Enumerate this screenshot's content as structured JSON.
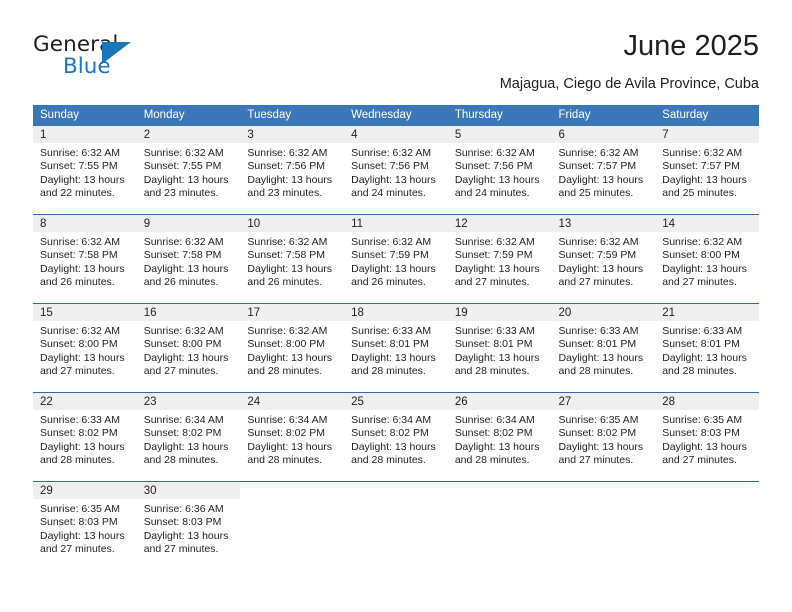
{
  "brand": {
    "name_top": "General",
    "name_bottom": "Blue",
    "accent_color": "#1b75bb",
    "text_color": "#231f20"
  },
  "header": {
    "title": "June 2025",
    "subtitle": "Majagua, Ciego de Avila Province, Cuba"
  },
  "calendar": {
    "header_bg": "#3a76b8",
    "header_text_color": "#ffffff",
    "daynum_bg": "#efefef",
    "row_divider_color": "#2f6aae",
    "weekdays": [
      "Sunday",
      "Monday",
      "Tuesday",
      "Wednesday",
      "Thursday",
      "Friday",
      "Saturday"
    ],
    "weeks": [
      [
        {
          "day": "1",
          "sunrise": "Sunrise: 6:32 AM",
          "sunset": "Sunset: 7:55 PM",
          "daylight_line1": "Daylight: 13 hours",
          "daylight_line2": "and 22 minutes."
        },
        {
          "day": "2",
          "sunrise": "Sunrise: 6:32 AM",
          "sunset": "Sunset: 7:55 PM",
          "daylight_line1": "Daylight: 13 hours",
          "daylight_line2": "and 23 minutes."
        },
        {
          "day": "3",
          "sunrise": "Sunrise: 6:32 AM",
          "sunset": "Sunset: 7:56 PM",
          "daylight_line1": "Daylight: 13 hours",
          "daylight_line2": "and 23 minutes."
        },
        {
          "day": "4",
          "sunrise": "Sunrise: 6:32 AM",
          "sunset": "Sunset: 7:56 PM",
          "daylight_line1": "Daylight: 13 hours",
          "daylight_line2": "and 24 minutes."
        },
        {
          "day": "5",
          "sunrise": "Sunrise: 6:32 AM",
          "sunset": "Sunset: 7:56 PM",
          "daylight_line1": "Daylight: 13 hours",
          "daylight_line2": "and 24 minutes."
        },
        {
          "day": "6",
          "sunrise": "Sunrise: 6:32 AM",
          "sunset": "Sunset: 7:57 PM",
          "daylight_line1": "Daylight: 13 hours",
          "daylight_line2": "and 25 minutes."
        },
        {
          "day": "7",
          "sunrise": "Sunrise: 6:32 AM",
          "sunset": "Sunset: 7:57 PM",
          "daylight_line1": "Daylight: 13 hours",
          "daylight_line2": "and 25 minutes."
        }
      ],
      [
        {
          "day": "8",
          "sunrise": "Sunrise: 6:32 AM",
          "sunset": "Sunset: 7:58 PM",
          "daylight_line1": "Daylight: 13 hours",
          "daylight_line2": "and 26 minutes."
        },
        {
          "day": "9",
          "sunrise": "Sunrise: 6:32 AM",
          "sunset": "Sunset: 7:58 PM",
          "daylight_line1": "Daylight: 13 hours",
          "daylight_line2": "and 26 minutes."
        },
        {
          "day": "10",
          "sunrise": "Sunrise: 6:32 AM",
          "sunset": "Sunset: 7:58 PM",
          "daylight_line1": "Daylight: 13 hours",
          "daylight_line2": "and 26 minutes."
        },
        {
          "day": "11",
          "sunrise": "Sunrise: 6:32 AM",
          "sunset": "Sunset: 7:59 PM",
          "daylight_line1": "Daylight: 13 hours",
          "daylight_line2": "and 26 minutes."
        },
        {
          "day": "12",
          "sunrise": "Sunrise: 6:32 AM",
          "sunset": "Sunset: 7:59 PM",
          "daylight_line1": "Daylight: 13 hours",
          "daylight_line2": "and 27 minutes."
        },
        {
          "day": "13",
          "sunrise": "Sunrise: 6:32 AM",
          "sunset": "Sunset: 7:59 PM",
          "daylight_line1": "Daylight: 13 hours",
          "daylight_line2": "and 27 minutes."
        },
        {
          "day": "14",
          "sunrise": "Sunrise: 6:32 AM",
          "sunset": "Sunset: 8:00 PM",
          "daylight_line1": "Daylight: 13 hours",
          "daylight_line2": "and 27 minutes."
        }
      ],
      [
        {
          "day": "15",
          "sunrise": "Sunrise: 6:32 AM",
          "sunset": "Sunset: 8:00 PM",
          "daylight_line1": "Daylight: 13 hours",
          "daylight_line2": "and 27 minutes."
        },
        {
          "day": "16",
          "sunrise": "Sunrise: 6:32 AM",
          "sunset": "Sunset: 8:00 PM",
          "daylight_line1": "Daylight: 13 hours",
          "daylight_line2": "and 27 minutes."
        },
        {
          "day": "17",
          "sunrise": "Sunrise: 6:32 AM",
          "sunset": "Sunset: 8:00 PM",
          "daylight_line1": "Daylight: 13 hours",
          "daylight_line2": "and 28 minutes."
        },
        {
          "day": "18",
          "sunrise": "Sunrise: 6:33 AM",
          "sunset": "Sunset: 8:01 PM",
          "daylight_line1": "Daylight: 13 hours",
          "daylight_line2": "and 28 minutes."
        },
        {
          "day": "19",
          "sunrise": "Sunrise: 6:33 AM",
          "sunset": "Sunset: 8:01 PM",
          "daylight_line1": "Daylight: 13 hours",
          "daylight_line2": "and 28 minutes."
        },
        {
          "day": "20",
          "sunrise": "Sunrise: 6:33 AM",
          "sunset": "Sunset: 8:01 PM",
          "daylight_line1": "Daylight: 13 hours",
          "daylight_line2": "and 28 minutes."
        },
        {
          "day": "21",
          "sunrise": "Sunrise: 6:33 AM",
          "sunset": "Sunset: 8:01 PM",
          "daylight_line1": "Daylight: 13 hours",
          "daylight_line2": "and 28 minutes."
        }
      ],
      [
        {
          "day": "22",
          "sunrise": "Sunrise: 6:33 AM",
          "sunset": "Sunset: 8:02 PM",
          "daylight_line1": "Daylight: 13 hours",
          "daylight_line2": "and 28 minutes."
        },
        {
          "day": "23",
          "sunrise": "Sunrise: 6:34 AM",
          "sunset": "Sunset: 8:02 PM",
          "daylight_line1": "Daylight: 13 hours",
          "daylight_line2": "and 28 minutes."
        },
        {
          "day": "24",
          "sunrise": "Sunrise: 6:34 AM",
          "sunset": "Sunset: 8:02 PM",
          "daylight_line1": "Daylight: 13 hours",
          "daylight_line2": "and 28 minutes."
        },
        {
          "day": "25",
          "sunrise": "Sunrise: 6:34 AM",
          "sunset": "Sunset: 8:02 PM",
          "daylight_line1": "Daylight: 13 hours",
          "daylight_line2": "and 28 minutes."
        },
        {
          "day": "26",
          "sunrise": "Sunrise: 6:34 AM",
          "sunset": "Sunset: 8:02 PM",
          "daylight_line1": "Daylight: 13 hours",
          "daylight_line2": "and 28 minutes."
        },
        {
          "day": "27",
          "sunrise": "Sunrise: 6:35 AM",
          "sunset": "Sunset: 8:02 PM",
          "daylight_line1": "Daylight: 13 hours",
          "daylight_line2": "and 27 minutes."
        },
        {
          "day": "28",
          "sunrise": "Sunrise: 6:35 AM",
          "sunset": "Sunset: 8:03 PM",
          "daylight_line1": "Daylight: 13 hours",
          "daylight_line2": "and 27 minutes."
        }
      ],
      [
        {
          "day": "29",
          "sunrise": "Sunrise: 6:35 AM",
          "sunset": "Sunset: 8:03 PM",
          "daylight_line1": "Daylight: 13 hours",
          "daylight_line2": "and 27 minutes."
        },
        {
          "day": "30",
          "sunrise": "Sunrise: 6:36 AM",
          "sunset": "Sunset: 8:03 PM",
          "daylight_line1": "Daylight: 13 hours",
          "daylight_line2": "and 27 minutes."
        },
        {
          "day": "",
          "sunrise": "",
          "sunset": "",
          "daylight_line1": "",
          "daylight_line2": ""
        },
        {
          "day": "",
          "sunrise": "",
          "sunset": "",
          "daylight_line1": "",
          "daylight_line2": ""
        },
        {
          "day": "",
          "sunrise": "",
          "sunset": "",
          "daylight_line1": "",
          "daylight_line2": ""
        },
        {
          "day": "",
          "sunrise": "",
          "sunset": "",
          "daylight_line1": "",
          "daylight_line2": ""
        },
        {
          "day": "",
          "sunrise": "",
          "sunset": "",
          "daylight_line1": "",
          "daylight_line2": ""
        }
      ]
    ]
  }
}
